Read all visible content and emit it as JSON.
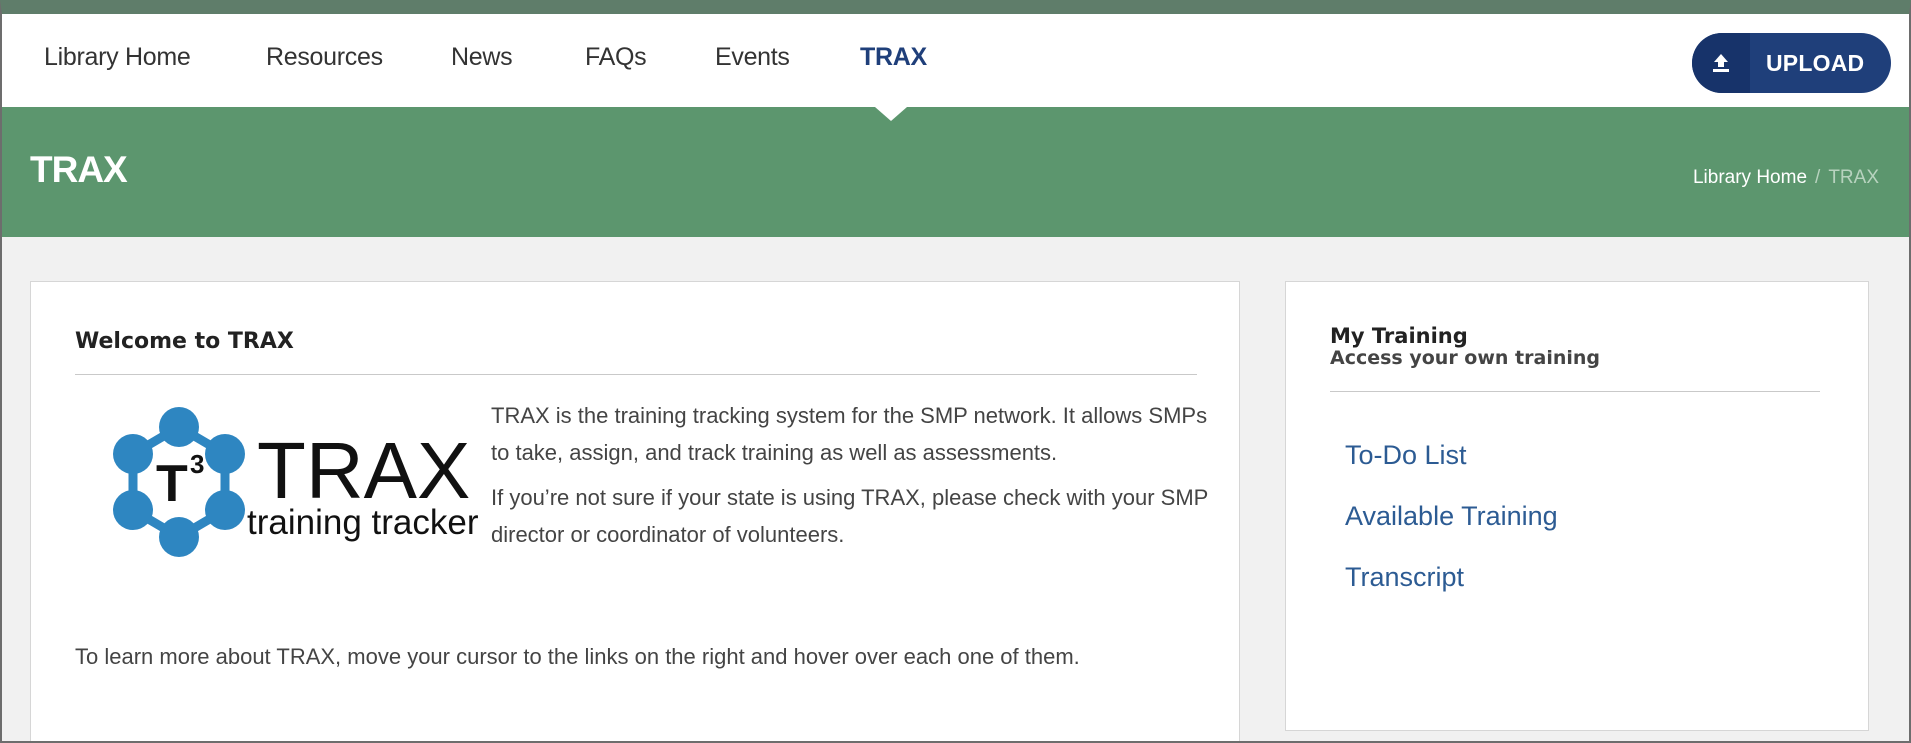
{
  "nav": {
    "items": [
      {
        "label": "Library Home"
      },
      {
        "label": "Resources"
      },
      {
        "label": "News"
      },
      {
        "label": "FAQs"
      },
      {
        "label": "Events"
      },
      {
        "label": "TRAX",
        "active": true
      }
    ],
    "upload_label": "UPLOAD"
  },
  "banner": {
    "title": "TRAX",
    "breadcrumb": [
      "Library Home",
      "TRAX"
    ]
  },
  "welcome": {
    "title": "Welcome to TRAX",
    "logo": {
      "text": "TRAX",
      "tagline": "training tracker"
    },
    "paragraphs": [
      "TRAX is the training tracking system for the SMP network. It allows SMPs to take, assign, and track training as well as assessments.",
      "If you’re not sure if your state is using TRAX, please check with your SMP director or coordinator of volunteers.",
      "To learn more about TRAX, move your cursor to the links on the right and hover over each one of them."
    ]
  },
  "my_training": {
    "title": "My Training",
    "subtitle": "Access your own training",
    "links": [
      "To-Do List",
      "Available Training",
      "Transcript"
    ]
  },
  "colors": {
    "brand_navy": "#1f3f7a",
    "banner_green": "#5c966e",
    "link_blue": "#2c5b93",
    "logo_blue": "#2e86c1"
  }
}
